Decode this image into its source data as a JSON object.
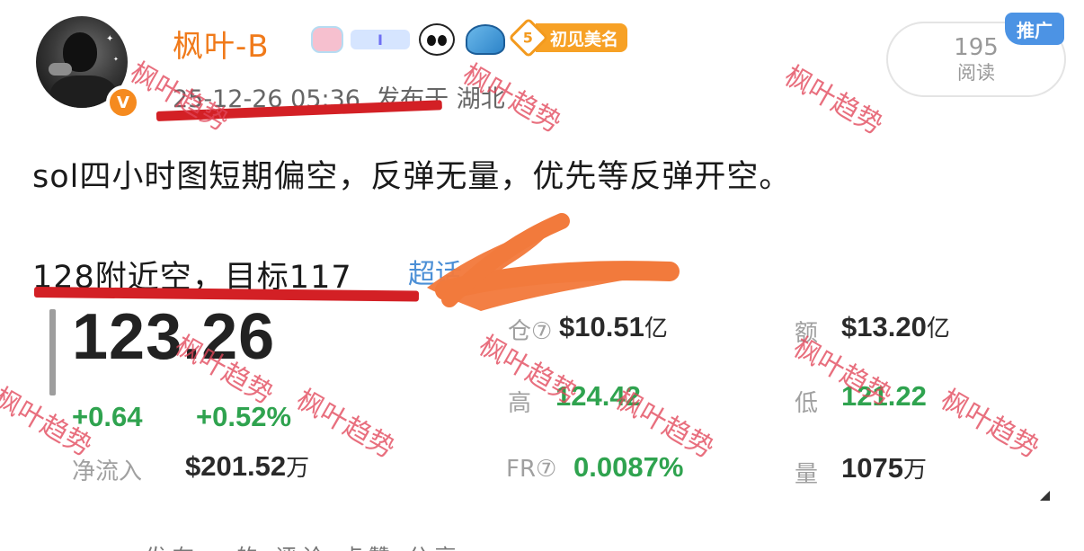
{
  "author": {
    "name": "枫叶-B",
    "level_number": "5",
    "level_title": "初见美名",
    "verified_mark": "V",
    "badge_bar_text": "I"
  },
  "post_meta": {
    "text": "25-12-26 05:36  发布于 湖北"
  },
  "promo_tag": "推广",
  "read_stats": {
    "count": "195",
    "label": "阅读"
  },
  "post": {
    "line1": "sol四小时图短期偏空，反弹无量，优先等反弹开空。",
    "line2": "128附近空，目标117",
    "hashtag_fragment": "超话"
  },
  "quote": {
    "price": "123.26",
    "change_abs": "+0.64",
    "change_pct": "+0.52%",
    "net_inflow_label": "净流入",
    "net_inflow_value": "$201.52",
    "net_inflow_unit": "万",
    "oi_label": "仓⑦",
    "oi_value": "$10.51",
    "oi_unit": "亿",
    "high_label": "高",
    "high_value": "124.42",
    "fr_label": "FR⑦",
    "fr_value": "0.0087%",
    "turnover_label": "额",
    "turnover_value": "$13.20",
    "turnover_unit": "亿",
    "low_label": "低",
    "low_value": "121.22",
    "volume_label": "量",
    "volume_value": "1075",
    "volume_unit": "万"
  },
  "bottom_cut_text": "·  ·  · 发布   · 的  评论  点赞  分享",
  "watermark": "枫叶趋势",
  "colors": {
    "username": "#f07a1a",
    "red_underline": "#d32025",
    "up_green": "#2fa34f",
    "scribble": "#f27a3c",
    "watermark": "#e2465a",
    "promo_blue": "#4c93e4"
  },
  "icons": [
    "verified-v-icon",
    "pig-badge-icon",
    "panda-badge-icon",
    "shark-badge-icon",
    "level-diamond-icon",
    "sort-triangle-icon"
  ]
}
